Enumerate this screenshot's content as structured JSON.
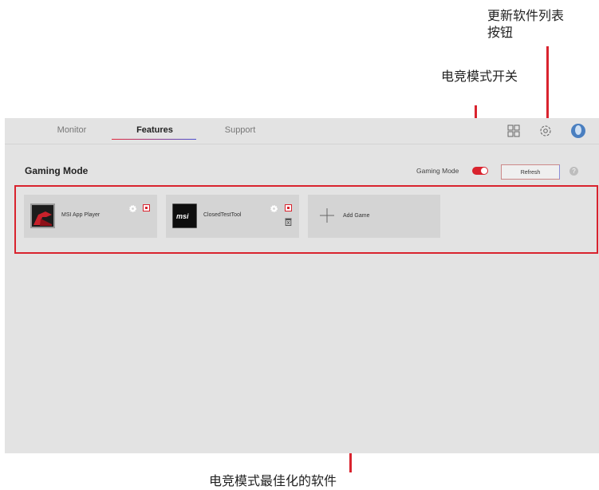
{
  "annotations": {
    "refresh_note_line1": "更新软件列表",
    "refresh_note_line2": "按钮",
    "gaming_toggle_note": "电竞模式开关",
    "optimize_note": "电竞模式最佳化的软件"
  },
  "nav": {
    "tabs": [
      {
        "label": "Monitor"
      },
      {
        "label": "Features"
      },
      {
        "label": "Support"
      }
    ],
    "icons": [
      "grid-icon",
      "gear-icon",
      "user-avatar"
    ]
  },
  "page": {
    "title": "Gaming Mode",
    "gaming_mode_label": "Gaming Mode",
    "gaming_mode_on": true,
    "refresh_label": "Refresh",
    "help_label": "?"
  },
  "games": [
    {
      "name": "MSI App Player"
    },
    {
      "name": "ClosedTestTool",
      "logo_text": "msi"
    }
  ],
  "add_game_label": "Add Game",
  "colors": {
    "accent": "#d9232e",
    "panel_bg": "#e3e3e3",
    "card_bg": "#d4d4d4",
    "tab_gradient_end": "#4a4fd0"
  }
}
